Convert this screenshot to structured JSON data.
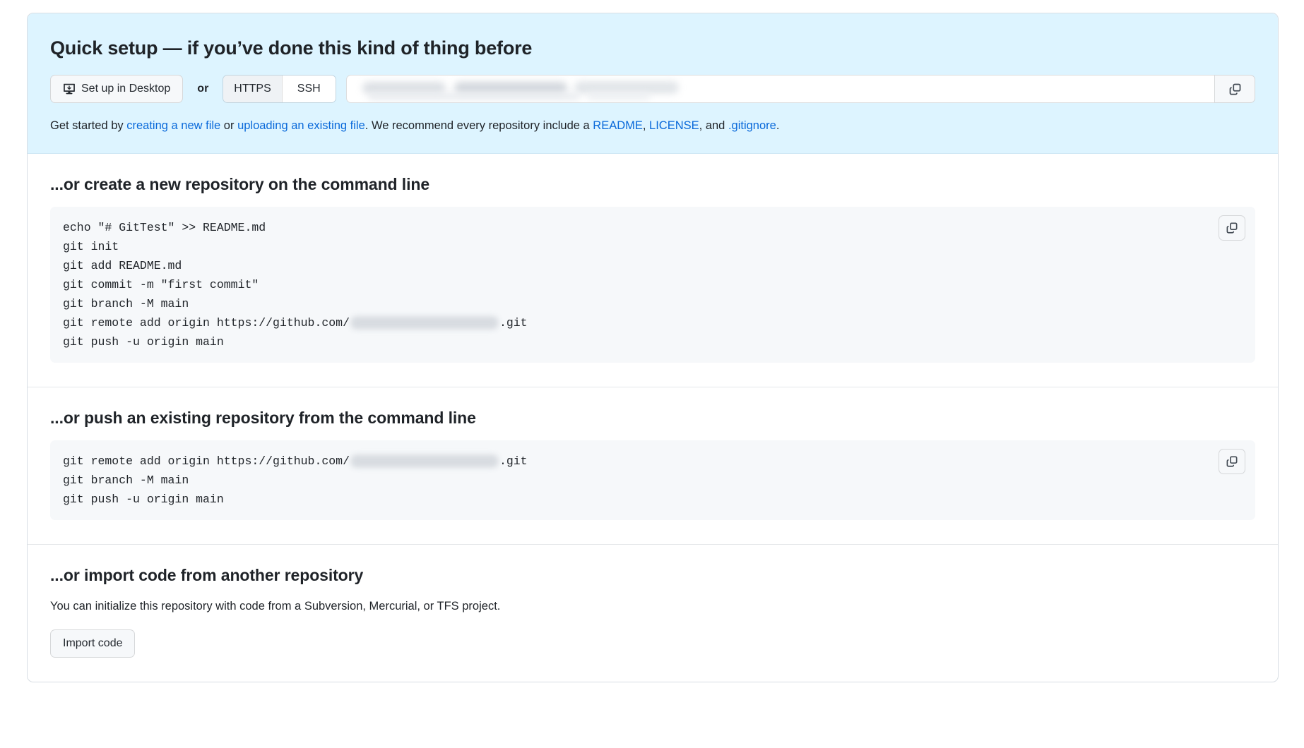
{
  "quick_setup": {
    "title": "Quick setup — if you’ve done this kind of thing before",
    "desktop_button": "Set up in Desktop",
    "or_label": "or",
    "protocols": [
      {
        "label": "HTTPS",
        "selected": true
      },
      {
        "label": "SSH",
        "selected": false
      }
    ],
    "url_value": "",
    "url_redacted": true,
    "copy_icon": "copy-icon",
    "desktop_icon": "desktop-download-icon",
    "note": {
      "prefix": "Get started by ",
      "link_new_file": "creating a new file",
      "mid1": " or ",
      "link_upload": "uploading an existing file",
      "mid2": ". We recommend every repository include a ",
      "link_readme": "README",
      "sep1": ", ",
      "link_license": "LICENSE",
      "sep2": ", and ",
      "link_gitignore": ".gitignore",
      "suffix": "."
    }
  },
  "create_section": {
    "title": "...or create a new repository on the command line",
    "copy_icon": "copy-icon",
    "lines": [
      {
        "text": "echo \"# GitTest\" >> README.md"
      },
      {
        "text": "git init"
      },
      {
        "text": "git add README.md"
      },
      {
        "text": "git commit -m \"first commit\""
      },
      {
        "text": "git branch -M main"
      },
      {
        "prefix": "git remote add origin https://github.com/",
        "redacted": true,
        "redact_width": 210,
        "suffix": ".git"
      },
      {
        "text": "git push -u origin main"
      }
    ]
  },
  "push_section": {
    "title": "...or push an existing repository from the command line",
    "copy_icon": "copy-icon",
    "lines": [
      {
        "prefix": "git remote add origin https://github.com/",
        "redacted": true,
        "redact_width": 210,
        "suffix": ".git"
      },
      {
        "text": "git branch -M main"
      },
      {
        "text": "git push -u origin main"
      }
    ]
  },
  "import_section": {
    "title": "...or import code from another repository",
    "description": "You can initialize this repository with code from a Subversion, Mercurial, or TFS project.",
    "button": "Import code"
  },
  "colors": {
    "banner_bg": "#ddf4ff",
    "link": "#0969da",
    "code_bg": "#f6f8fa",
    "text": "#1f2328",
    "border": "#d8dee4"
  }
}
